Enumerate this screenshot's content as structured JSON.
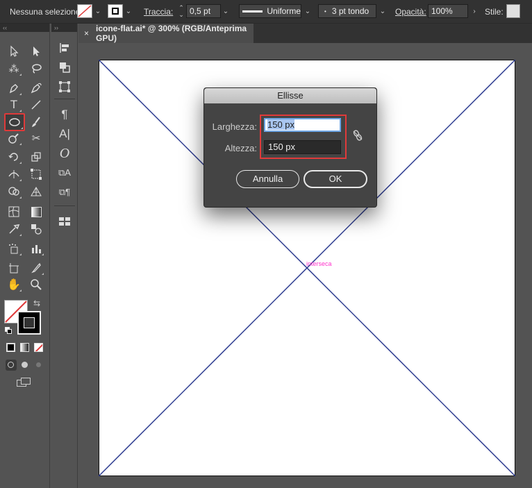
{
  "control_bar": {
    "selection": "Nessuna selezione",
    "stroke_label": "Traccia:",
    "stroke_weight": "0,5 pt",
    "profile": "Uniforme",
    "brush": "3 pt tondo",
    "opacity_label": "Opacità:",
    "opacity": "100%",
    "style_label": "Stile:"
  },
  "tools_header": "‹‹",
  "panel2_header": "››",
  "document_tab": {
    "close": "×",
    "title": "icone-flat.ai* @ 300% (RGB/Anteprima GPU)"
  },
  "artboard": {
    "smart_guide": "interseca",
    "line_color": "#2b3a8f"
  },
  "dialog": {
    "title": "Ellisse",
    "width_label": "Larghezza:",
    "width_value": "150 px",
    "height_label": "Altezza:",
    "height_value": "150 px",
    "cancel_label": "Annulla",
    "ok_label": "OK"
  },
  "colors": {
    "highlight": "#e03a3a",
    "focus": "#6fa7e6"
  }
}
